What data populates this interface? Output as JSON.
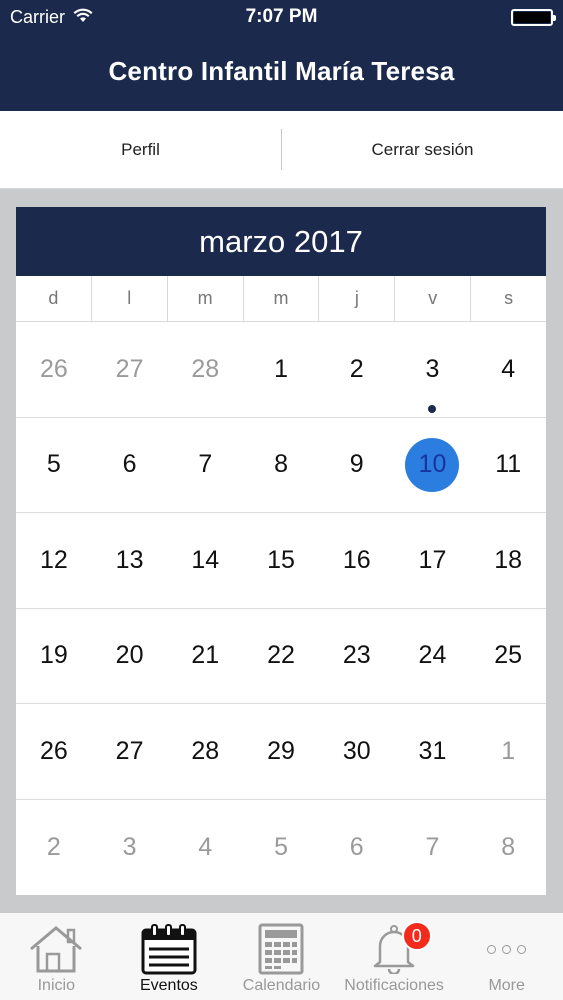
{
  "status_bar": {
    "carrier": "Carrier",
    "time": "7:07 PM"
  },
  "header": {
    "title": "Centro Infantil María Teresa"
  },
  "top_tabs": [
    {
      "label": "Perfil"
    },
    {
      "label": "Cerrar sesión"
    }
  ],
  "calendar": {
    "month_label": "marzo 2017",
    "weekdays": [
      "d",
      "l",
      "m",
      "m",
      "j",
      "v",
      "s"
    ],
    "weeks": [
      [
        {
          "d": "26",
          "muted": true
        },
        {
          "d": "27",
          "muted": true
        },
        {
          "d": "28",
          "muted": true
        },
        {
          "d": "1"
        },
        {
          "d": "2"
        },
        {
          "d": "3",
          "event": true
        },
        {
          "d": "4"
        }
      ],
      [
        {
          "d": "5"
        },
        {
          "d": "6"
        },
        {
          "d": "7"
        },
        {
          "d": "8"
        },
        {
          "d": "9"
        },
        {
          "d": "10",
          "selected": true
        },
        {
          "d": "11"
        }
      ],
      [
        {
          "d": "12"
        },
        {
          "d": "13"
        },
        {
          "d": "14"
        },
        {
          "d": "15"
        },
        {
          "d": "16"
        },
        {
          "d": "17"
        },
        {
          "d": "18"
        }
      ],
      [
        {
          "d": "19"
        },
        {
          "d": "20"
        },
        {
          "d": "21"
        },
        {
          "d": "22"
        },
        {
          "d": "23"
        },
        {
          "d": "24"
        },
        {
          "d": "25"
        }
      ],
      [
        {
          "d": "26"
        },
        {
          "d": "27"
        },
        {
          "d": "28"
        },
        {
          "d": "29"
        },
        {
          "d": "30"
        },
        {
          "d": "31"
        },
        {
          "d": "1",
          "muted": true
        }
      ],
      [
        {
          "d": "2",
          "muted": true
        },
        {
          "d": "3",
          "muted": true
        },
        {
          "d": "4",
          "muted": true
        },
        {
          "d": "5",
          "muted": true
        },
        {
          "d": "6",
          "muted": true
        },
        {
          "d": "7",
          "muted": true
        },
        {
          "d": "8",
          "muted": true
        }
      ]
    ]
  },
  "tab_bar": {
    "items": [
      {
        "label": "Inicio",
        "icon": "home-icon"
      },
      {
        "label": "Eventos",
        "icon": "calendar-events-icon",
        "active": true
      },
      {
        "label": "Calendario",
        "icon": "calendar-grid-icon"
      },
      {
        "label": "Notificaciones",
        "icon": "bell-icon",
        "badge": "0"
      },
      {
        "label": "More",
        "icon": "more-icon"
      }
    ]
  },
  "colors": {
    "navy": "#1b2a4c",
    "selected": "#2b7de0",
    "badge": "#f22b1d"
  }
}
